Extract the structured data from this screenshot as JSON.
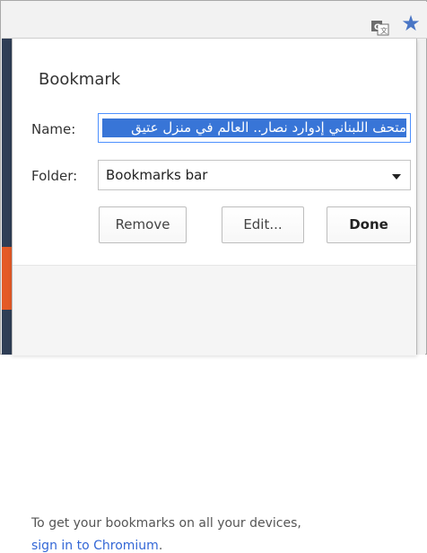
{
  "toolbar": {
    "translate_icon": "translate-icon",
    "star_icon": "star-icon",
    "star_color": "#4a76c5"
  },
  "dialog": {
    "title": "Bookmark",
    "name_label": "Name:",
    "name_value": "متحف اللبناني إدوارد نصار.. العالم في منزل عتيق",
    "folder_label": "Folder:",
    "folder_value": "Bookmarks bar",
    "buttons": {
      "remove": "Remove",
      "edit": "Edit...",
      "done": "Done"
    }
  },
  "footer": {
    "line1": "To get your bookmarks on all your devices,",
    "link": "sign in to Chromium",
    "link_suffix": ".",
    "link_color": "#3367d6"
  }
}
